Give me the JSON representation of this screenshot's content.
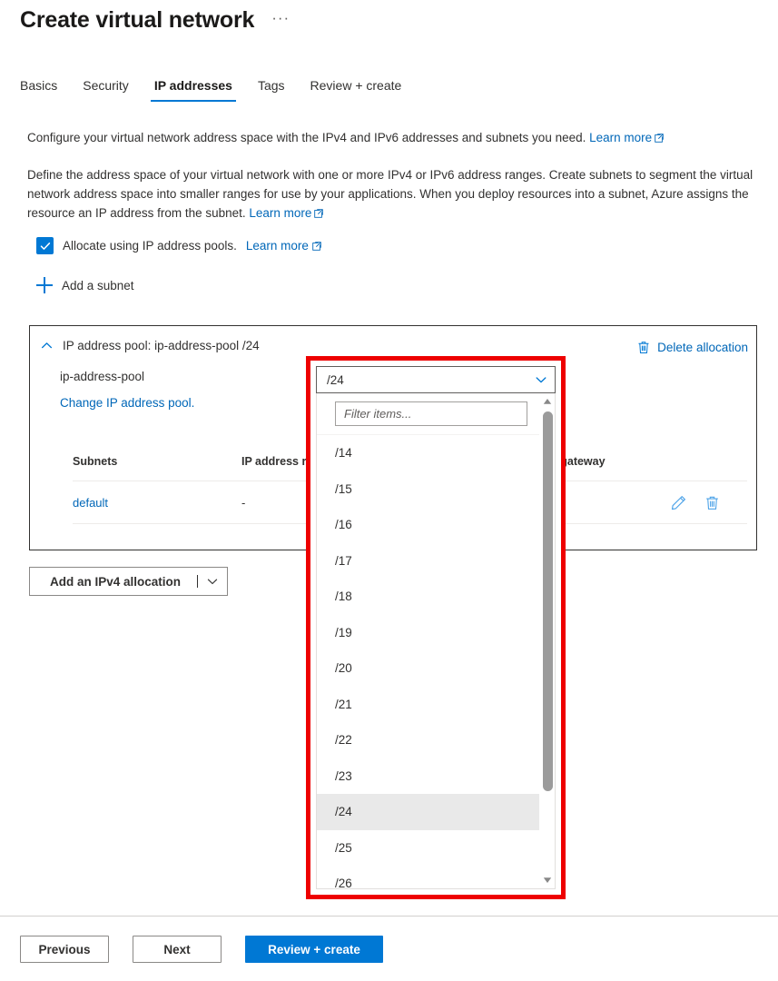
{
  "header": {
    "title": "Create virtual network",
    "more_label": "···"
  },
  "tabs": [
    {
      "label": "Basics",
      "active": false
    },
    {
      "label": "Security",
      "active": false
    },
    {
      "label": "IP addresses",
      "active": true
    },
    {
      "label": "Tags",
      "active": false
    },
    {
      "label": "Review + create",
      "active": false
    }
  ],
  "intro": {
    "paragraph1": "Configure your virtual network address space with the IPv4 and IPv6 addresses and subnets you need. ",
    "paragraph1_link": "Learn more",
    "paragraph2": "Define the address space of your virtual network with one or more IPv4 or IPv6 address ranges. Create subnets to segment the virtual network address space into smaller ranges for use by your applications. When you deploy resources into a subnet, Azure assigns the resource an IP address from the subnet. ",
    "paragraph2_link": "Learn more"
  },
  "allocate_checkbox": {
    "label": "Allocate using IP address pools.",
    "link": "Learn more",
    "checked": true
  },
  "add_subnet": {
    "label": "Add a subnet"
  },
  "pool_panel": {
    "header": "IP address pool: ip-address-pool /24",
    "pool_name": "ip-address-pool",
    "change_link": "Change IP address pool.",
    "delete_allocation": "Delete allocation",
    "table": {
      "columns": [
        "Subnets",
        "IP address r",
        "NAT gateway"
      ],
      "rows": [
        {
          "subnet": "default",
          "range": "-",
          "nat": ""
        }
      ]
    }
  },
  "add_allocation": {
    "label": "Add an IPv4 allocation"
  },
  "dropdown": {
    "selected_value": "/24",
    "filter_placeholder": "Filter items...",
    "options": [
      "/14",
      "/15",
      "/16",
      "/17",
      "/18",
      "/19",
      "/20",
      "/21",
      "/22",
      "/23",
      "/24",
      "/25",
      "/26"
    ]
  },
  "footer": {
    "previous": "Previous",
    "next": "Next",
    "review_create": "Review + create"
  },
  "colors": {
    "accent": "#0078d4",
    "link": "#0067b8",
    "highlight_box": "#ee0000",
    "selected_item_bg": "#e9e9e9"
  }
}
